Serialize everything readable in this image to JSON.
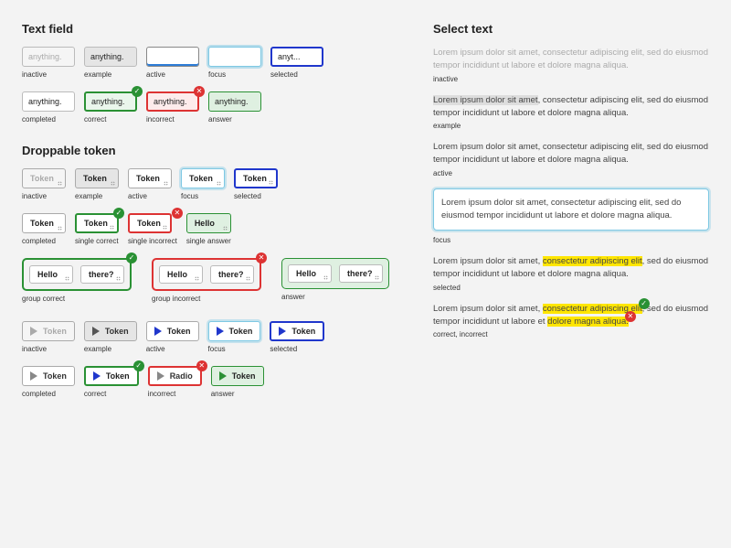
{
  "sections": {
    "textfield": "Text field",
    "droppable": "Droppable token",
    "selecttext": "Select text"
  },
  "labels": {
    "inactive": "inactive",
    "example": "example",
    "active": "active",
    "focus": "focus",
    "selected": "selected",
    "completed": "completed",
    "correct": "correct",
    "incorrect": "incorrect",
    "answer": "answer",
    "single_correct": "single correct",
    "single_incorrect": "single incorrect",
    "single_answer": "single answer",
    "group_correct": "group correct",
    "group_incorrect": "group incorrect",
    "correct_incorrect": "correct, incorrect"
  },
  "tf": {
    "placeholder": "anything.",
    "value": "anything.",
    "truncated": "anyt..."
  },
  "tok": {
    "token": "Token",
    "hello": "Hello",
    "there": "there?",
    "radio": "Radio"
  },
  "lorem": "Lorem ipsum dolor sit amet, consectetur adipiscing elit, sed do eiusmod tempor incididunt ut labore et dolore magna aliqua.",
  "lorem_parts": {
    "pre1": "Lorem ipsum dolor sit amet",
    "post1": ", consectetur adipiscing elit, sed do eiusmod tempor incididunt ut labore et dolore magna aliqua.",
    "sel_pre": "Lorem ipsum dolor sit amet, ",
    "sel_hl": "consectetur adipiscing elit",
    "sel_mid": ", sed do eiusmod tempor incididunt ut labore et ",
    "sel_hl2": "dolore magna aliqua.",
    "sel_post": ", sed do eiusmod tempor incididunt ut labore et dolore magna aliqua."
  }
}
